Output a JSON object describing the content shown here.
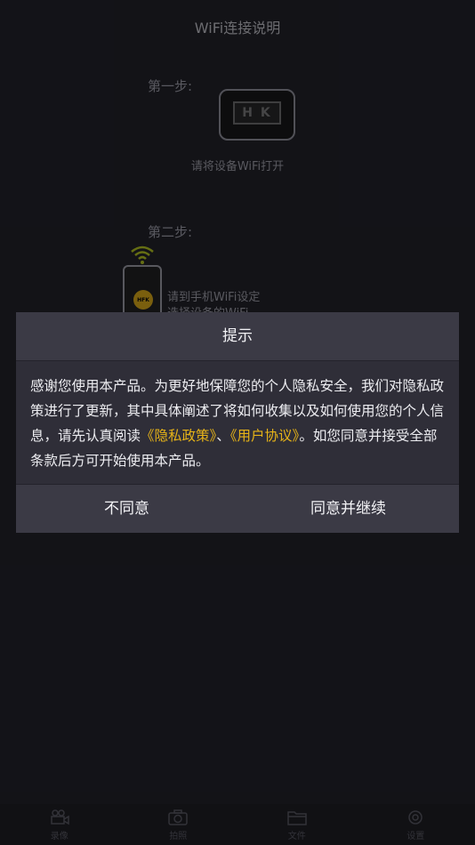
{
  "page": {
    "title": "WiFi连接说明",
    "step1_label": "第一步:",
    "device_screen_text": "H K",
    "step1_caption": "请将设备WiFi打开",
    "step2_label": "第二步:",
    "phone_badge": "HFK",
    "step2_caption_line1": "请到手机WiFi设定",
    "step2_caption_line2": "选择设备的WiFi"
  },
  "dialog": {
    "title": "提示",
    "body_text_1": "感谢您使用本产品。为更好地保障您的个人隐私安全，我们对隐私政策进行了更新，其中具体阐述了将如何收集以及如何使用您的个人信息，请先认真阅读",
    "privacy_link": "《隐私政策》",
    "separator": "、",
    "agreement_link": "《用户协议》",
    "body_text_2": "。如您同意并接受全部条款后方可开始使用本产品。",
    "disagree_label": "不同意",
    "agree_label": "同意并继续"
  },
  "tabbar": {
    "items": [
      {
        "label": "录像",
        "icon": "video-camera-icon"
      },
      {
        "label": "拍照",
        "icon": "camera-icon"
      },
      {
        "label": "文件",
        "icon": "folder-icon"
      },
      {
        "label": "设置",
        "icon": "gear-icon"
      }
    ]
  },
  "colors": {
    "background": "#1c1c22",
    "dialog": "#2f2e38",
    "dialog_header": "#3b3a45",
    "link": "#e6b318",
    "wifi_accent": "#b1c11a"
  }
}
